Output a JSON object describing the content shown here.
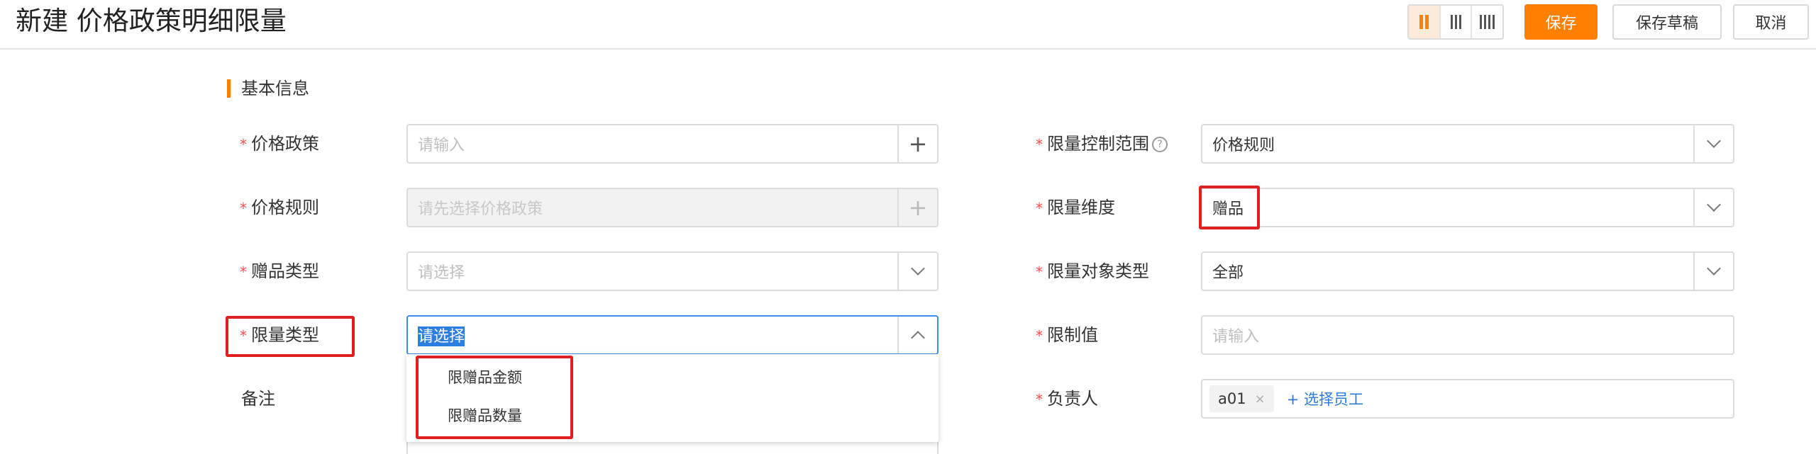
{
  "header": {
    "title": "新建 价格政策明细限量",
    "save_label": "保存",
    "save_draft_label": "保存草稿",
    "cancel_label": "取消"
  },
  "section": {
    "title": "基本信息"
  },
  "left": {
    "price_policy": {
      "label": "价格政策",
      "placeholder": "请输入"
    },
    "price_rule": {
      "label": "价格规则",
      "placeholder": "请先选择价格政策"
    },
    "gift_type": {
      "label": "赠品类型",
      "placeholder": "请选择"
    },
    "limit_type": {
      "label": "限量类型",
      "placeholder": "请选择"
    },
    "remark": {
      "label": "备注"
    }
  },
  "right": {
    "limit_scope": {
      "label": "限量控制范围",
      "value": "价格规则",
      "help": "?"
    },
    "limit_dimension": {
      "label": "限量维度",
      "value": "赠品"
    },
    "limit_object_type": {
      "label": "限量对象类型",
      "value": "全部"
    },
    "limit_value": {
      "label": "限制值",
      "placeholder": "请输入"
    },
    "owner": {
      "label": "负责人",
      "tag": "a01",
      "tag_close": "×",
      "add_label": "+ 选择员工"
    }
  },
  "dropdown": {
    "options": [
      "限赠品金额",
      "限赠品数量"
    ]
  },
  "required_mark": "*",
  "plus_glyph": "+",
  "colors": {
    "accent": "#ff8000",
    "required": "#ff4d4f",
    "highlight": "#e02020",
    "link": "#2b7cd6"
  }
}
